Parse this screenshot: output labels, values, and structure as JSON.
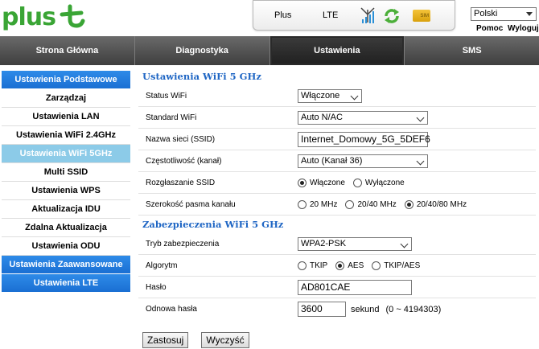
{
  "header": {
    "logo_text": "plus",
    "operator": "Plus",
    "network": "LTE",
    "sim_label": "SIM",
    "language": "Polski",
    "help_link": "Pomoc",
    "logout_link": "Wyloguj",
    "brand_color": "#3aa535"
  },
  "nav": {
    "tabs": [
      "Strona Główna",
      "Diagnostyka",
      "Ustawienia",
      "SMS"
    ],
    "active": "Ustawienia"
  },
  "sidebar": {
    "items": [
      {
        "label": "Ustawienia Podstawowe",
        "type": "header"
      },
      {
        "label": "Zarządzaj",
        "type": "item"
      },
      {
        "label": "Ustawienia LAN",
        "type": "item"
      },
      {
        "label": "Ustawienia WiFi 2.4GHz",
        "type": "item"
      },
      {
        "label": "Ustawienia WiFi 5GHz",
        "type": "active"
      },
      {
        "label": "Multi SSID",
        "type": "item"
      },
      {
        "label": "Ustawienia WPS",
        "type": "item"
      },
      {
        "label": "Aktualizacja IDU",
        "type": "item"
      },
      {
        "label": "Zdalna Aktualizacja",
        "type": "item"
      },
      {
        "label": "Ustawienia ODU",
        "type": "item"
      },
      {
        "label": "Ustawienia Zaawansowane",
        "type": "header"
      },
      {
        "label": "Ustawienia LTE",
        "type": "header"
      }
    ]
  },
  "wifi": {
    "title": "Ustawienia WiFi 5 GHz",
    "status_label": "Status WiFi",
    "status_value": "Włączone",
    "standard_label": "Standard WiFi",
    "standard_value": "Auto N/AC",
    "ssid_label": "Nazwa sieci (SSID)",
    "ssid_value": "Internet_Domowy_5G_5DEF6",
    "channel_label": "Częstotliwość (kanał)",
    "channel_value": "Auto (Kanał 36)",
    "broadcast_label": "Rozgłaszanie SSID",
    "broadcast_on": "Włączone",
    "broadcast_off": "Wyłączone",
    "bandwidth_label": "Szerokość pasma kanału",
    "bw_20": "20 MHz",
    "bw_40": "20/40 MHz",
    "bw_80": "20/40/80 MHz"
  },
  "security": {
    "title": "Zabezpieczenia WiFi 5 GHz",
    "mode_label": "Tryb zabezpieczenia",
    "mode_value": "WPA2-PSK",
    "algo_label": "Algorytm",
    "algo_tkip": "TKIP",
    "algo_aes": "AES",
    "algo_both": "TKIP/AES",
    "password_label": "Hasło",
    "password_value": "AD801CAE",
    "renew_label": "Odnowa hasła",
    "renew_value": "3600",
    "renew_unit": "sekund",
    "renew_range": "(0 ~ 4194303)"
  },
  "buttons": {
    "apply": "Zastosuj",
    "clear": "Wyczyść"
  }
}
